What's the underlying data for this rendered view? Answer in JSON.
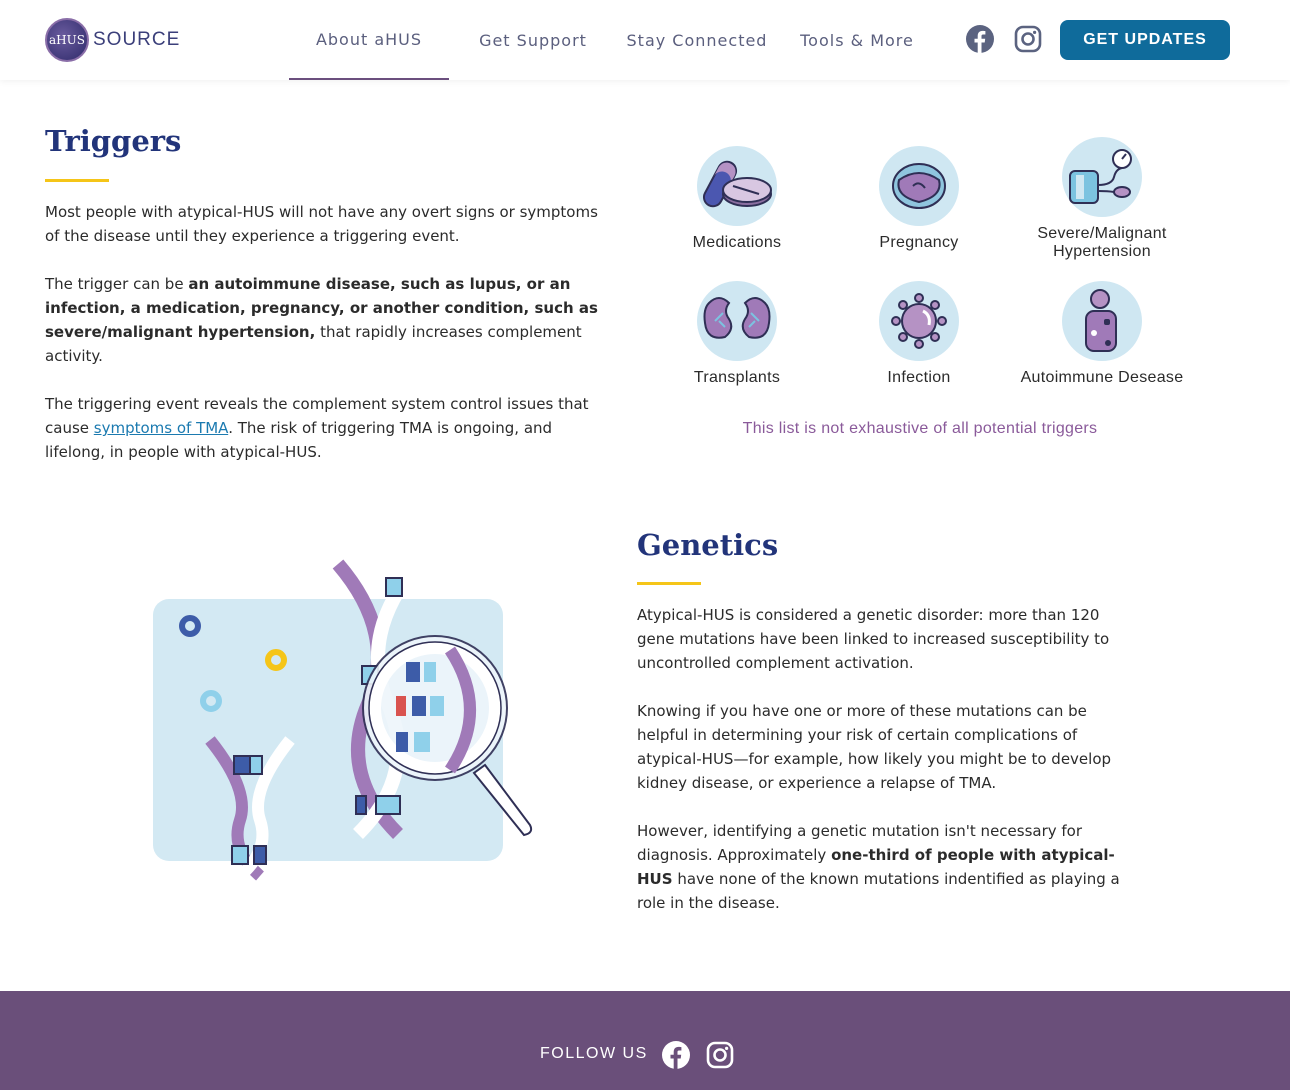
{
  "header": {
    "logo_badge": "aHUS",
    "logo_text": "SOURCE",
    "nav": [
      {
        "label": "About aHUS"
      },
      {
        "label": "Get Support"
      },
      {
        "label": "Stay Connected"
      },
      {
        "label": "Tools & More"
      }
    ],
    "cta_label": "GET UPDATES"
  },
  "triggers": {
    "title": "Triggers",
    "p1": "Most people with atypical-HUS will not have any overt signs or symptoms of the disease until they experience a triggering event.",
    "p2_pre": "The trigger can be ",
    "p2_bold": "an autoimmune disease, such as lupus, or an infection, a medication, pregnancy, or another condition, such as severe/malignant hypertension,",
    "p2_post": " that rapidly increases complement activity.",
    "p3_pre": "The triggering event reveals the complement system control issues that cause ",
    "p3_link": "symptoms of TMA",
    "p3_post": ". The risk of triggering TMA is ongoing, and lifelong, in people with atypical-HUS.",
    "items": [
      {
        "label": "Medications",
        "icon": "pills-icon"
      },
      {
        "label": "Pregnancy",
        "icon": "uterus-icon"
      },
      {
        "label": "Severe/Malignant Hypertension",
        "icon": "blood-pressure-icon"
      },
      {
        "label": "Transplants",
        "icon": "kidneys-icon"
      },
      {
        "label": "Infection",
        "icon": "virus-icon"
      },
      {
        "label": "Autoimmune Desease",
        "icon": "cell-icon"
      }
    ],
    "note": "This list is not exhaustive of all potential triggers"
  },
  "genetics": {
    "title": "Genetics",
    "p1": "Atypical-HUS is considered a genetic disorder: more than 120 gene mutations have been linked to increased susceptibility to uncontrolled complement activation.",
    "p2": "Knowing if you have one or more of these mutations can be helpful in determining your risk of certain complications of atypical-HUS—for example, how likely you might be to develop kidney disease, or experience a relapse of TMA.",
    "p3_pre": "However, identifying a genetic mutation isn't necessary for diagnosis. Approximately ",
    "p3_bold": "one-third of people with atypical-HUS",
    "p3_post": " have none of the known mutations indentified as playing a role in the disease."
  },
  "footer": {
    "follow_label": "FOLLOW US"
  },
  "colors": {
    "brand_navy": "#22347a",
    "accent_yellow": "#f5c518",
    "cta_blue": "#0f6b9b",
    "footer_purple": "#6a4f7a",
    "icon_bg": "#cfe7f2"
  }
}
